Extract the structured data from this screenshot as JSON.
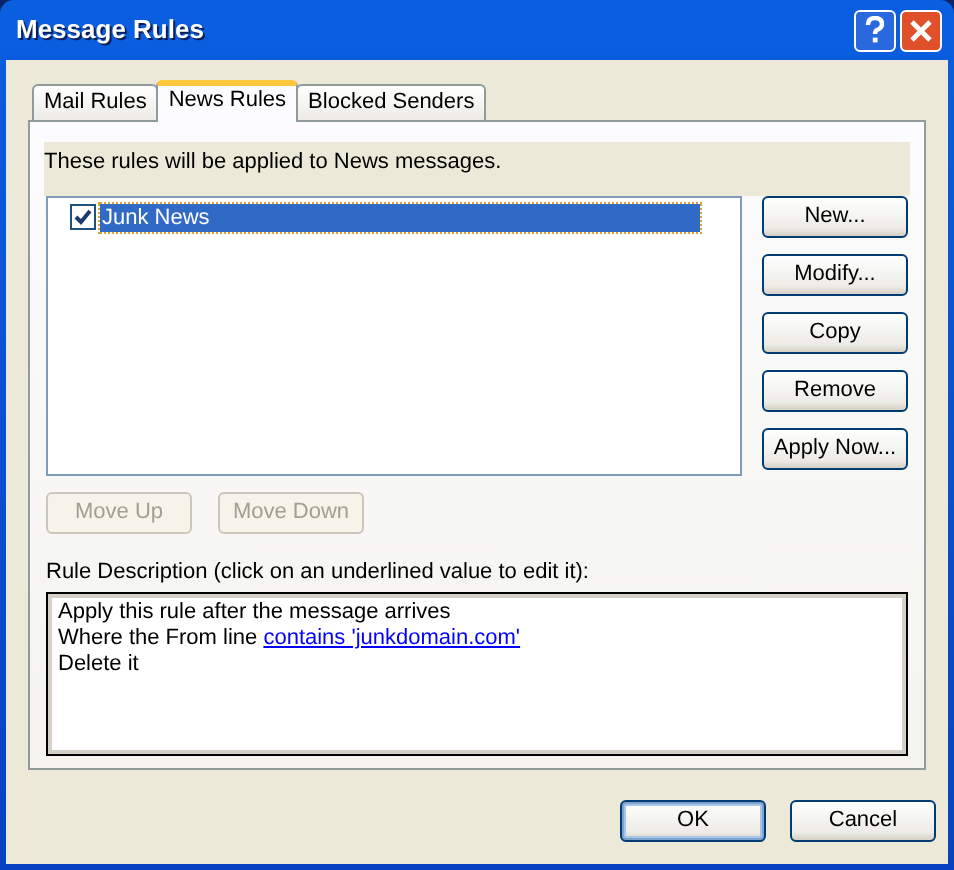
{
  "window": {
    "title": "Message Rules"
  },
  "tabs": [
    {
      "label": "Mail Rules",
      "selected": false
    },
    {
      "label": "News Rules",
      "selected": true
    },
    {
      "label": "Blocked Senders",
      "selected": false
    }
  ],
  "intro": "These rules will be applied to News messages.",
  "rules": [
    {
      "name": "Junk News",
      "checked": true,
      "selected": true
    }
  ],
  "side_buttons": [
    "New...",
    "Modify...",
    "Copy",
    "Remove",
    "Apply Now..."
  ],
  "move_buttons": [
    {
      "label": "Move Up",
      "disabled": true
    },
    {
      "label": "Move Down",
      "disabled": true
    }
  ],
  "description_label": "Rule Description (click on an underlined value to edit it):",
  "description_lines": [
    {
      "text": "Apply this rule after the message arrives"
    },
    {
      "text": "Where the From line ",
      "link": "contains 'junkdomain.com'"
    },
    {
      "text": "Delete it"
    }
  ],
  "footer_buttons": [
    {
      "label": "OK",
      "default": true
    },
    {
      "label": "Cancel",
      "default": false
    }
  ]
}
